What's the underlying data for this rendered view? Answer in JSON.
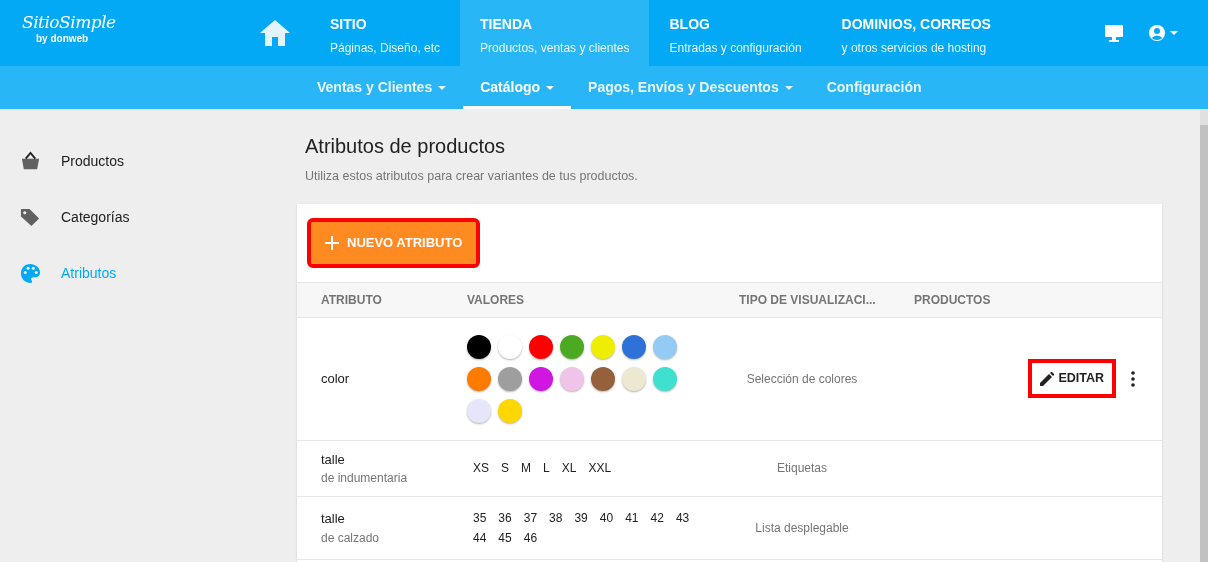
{
  "logo": {
    "name": "SitioSimple",
    "byline": "by donweb"
  },
  "main_nav": [
    {
      "title": "SITIO",
      "subtitle": "Páginas, Diseño, etc",
      "selected": false
    },
    {
      "title": "TIENDA",
      "subtitle": "Productos, ventas y clientes",
      "selected": true
    },
    {
      "title": "BLOG",
      "subtitle": "Entradas y configuración",
      "selected": false
    },
    {
      "title": "DOMINIOS, CORREOS",
      "subtitle": "y otros servicios de hosting",
      "selected": false
    }
  ],
  "sub_nav": [
    {
      "label": "Ventas y Clientes",
      "dropdown": true,
      "selected": false
    },
    {
      "label": "Catálogo",
      "dropdown": true,
      "selected": true
    },
    {
      "label": "Pagos, Envíos y Descuentos",
      "dropdown": true,
      "selected": false
    },
    {
      "label": "Configuración",
      "dropdown": false,
      "selected": false
    }
  ],
  "sidebar": {
    "items": [
      {
        "label": "Productos",
        "kind": "basket",
        "selected": false
      },
      {
        "label": "Categorías",
        "kind": "tags",
        "selected": false
      },
      {
        "label": "Atributos",
        "kind": "palette",
        "selected": true
      }
    ]
  },
  "page": {
    "title": "Atributos de productos",
    "subtitle": "Utiliza estos atributos para crear variantes de tus productos."
  },
  "new_button": {
    "label": "NUEVO ATRIBUTO",
    "highlighted": true
  },
  "table": {
    "columns": [
      "ATRIBUTO",
      "VALORES",
      "TIPO DE VISUALIZACI...",
      "PRODUCTOS"
    ],
    "rows": [
      {
        "name": "color",
        "kind": "swatches",
        "values": [
          {
            "color": "#000000"
          },
          {
            "color": "#ffffff"
          },
          {
            "color": "#ff0000"
          },
          {
            "color": "#4caa22"
          },
          {
            "color": "#eeee00"
          },
          {
            "color": "#2e72d9"
          },
          {
            "color": "#94cbf4"
          },
          {
            "color": "#ff7b00"
          },
          {
            "color": "#9e9e9e"
          },
          {
            "color": "#d016e0"
          },
          {
            "color": "#f0c3e8"
          },
          {
            "color": "#94613c"
          },
          {
            "color": "#ede8d2"
          },
          {
            "color": "#40e0d0"
          },
          {
            "color": "#e6e6fa"
          },
          {
            "color": "#ffd700"
          }
        ],
        "display": "Selección de colores",
        "edit_label": "EDITAR",
        "edit_highlighted": true
      },
      {
        "name": "talle",
        "detail": "de indumentaria",
        "kind": "labels",
        "values": [
          "XS",
          "S",
          "M",
          "L",
          "XL",
          "XXL"
        ],
        "display": "Etiquetas"
      },
      {
        "name": "talle",
        "detail": "de calzado",
        "kind": "labels",
        "values": [
          "35",
          "36",
          "37",
          "38",
          "39",
          "40",
          "41",
          "42",
          "43",
          "44",
          "45",
          "46"
        ],
        "display": "Lista desplegable"
      }
    ]
  }
}
